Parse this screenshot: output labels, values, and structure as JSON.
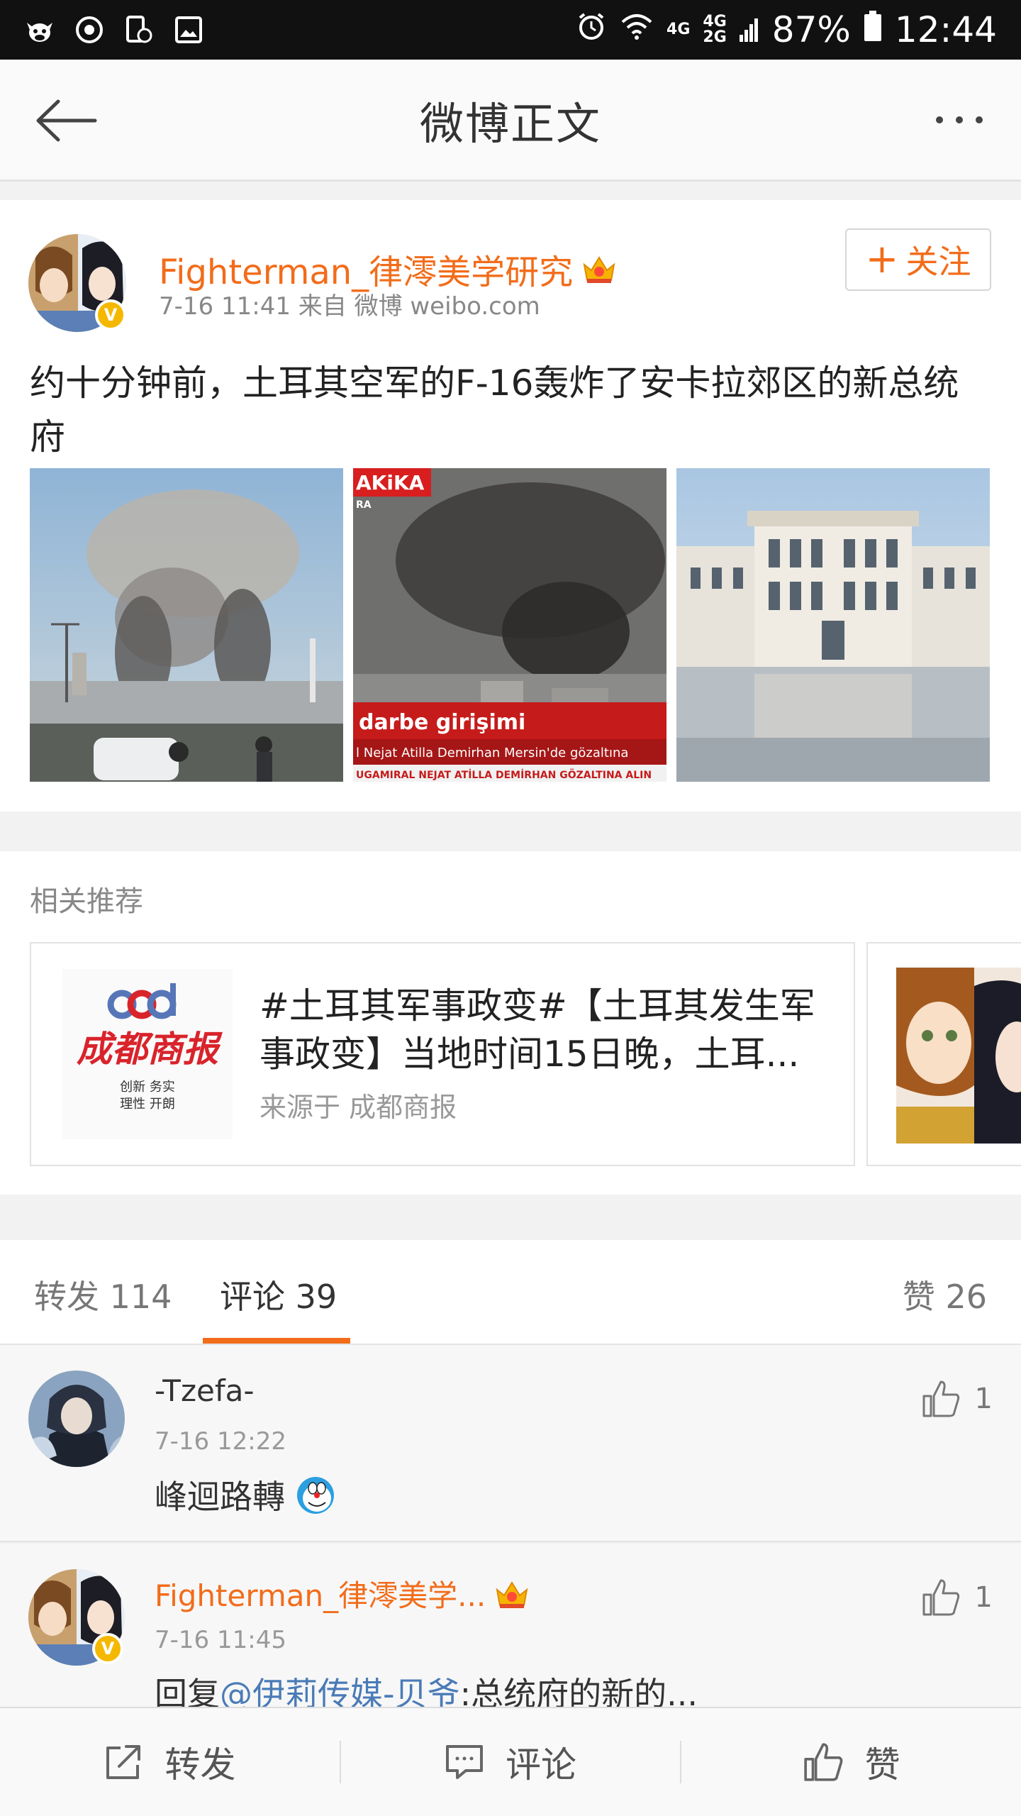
{
  "status_bar": {
    "battery": "87%",
    "time": "12:44",
    "network_top": "4G",
    "network_mid": "4G",
    "network_bottom": "2G"
  },
  "header": {
    "title": "微博正文"
  },
  "post": {
    "username": "Fighterman_律澪美学研究",
    "meta": "7-16 11:41  来自 微博 weibo.com",
    "follow_label": "关注",
    "follow_plus": "+",
    "verified_mark": "V",
    "text": "约十分钟前，土耳其空军的F-16轰炸了安卡拉郊区的新总统府",
    "images": [
      {
        "overlay": ""
      },
      {
        "overlay_top": "AKiKA",
        "overlay_top_small": "RA",
        "overlay_line1": "darbe girişimi",
        "overlay_line2": "l Nejat Atilla Demirhan Mersin'de gözaltına",
        "overlay_line3": "UGAMIRAL NEJAT ATİLLA DEMİRHAN GÖZALTINA ALIN"
      },
      {
        "overlay": ""
      }
    ]
  },
  "related": {
    "label": "相关推荐",
    "card": {
      "title": "#土耳其军事政变#【土耳其发生军事政变】当地时间15日晚，土耳...",
      "source": "来源于 成都商报",
      "logo_text": "成都商报",
      "logo_sub1": "创新  务实",
      "logo_sub2": "理性  开朗"
    }
  },
  "tabs": {
    "repost": "转发 114",
    "comments": "评论 39",
    "likes": "赞 26"
  },
  "comments": [
    {
      "name": "-Tzefa-",
      "time": "7-16 12:22",
      "text": "峰迴路轉",
      "likes": "1"
    },
    {
      "name": "Fighterman_律澪美学...",
      "time": "7-16 11:45",
      "text_prefix": "回复",
      "mention": "@伊莉传媒-贝爷",
      "text_suffix": ":总统府的新的...",
      "likes": "1",
      "verified_mark": "V"
    }
  ],
  "bottom_bar": {
    "repost": "转发",
    "comment": "评论",
    "like": "赞"
  },
  "colors": {
    "accent": "#f26c1a",
    "mention": "#4a7bb7",
    "verified": "#f5b800"
  }
}
